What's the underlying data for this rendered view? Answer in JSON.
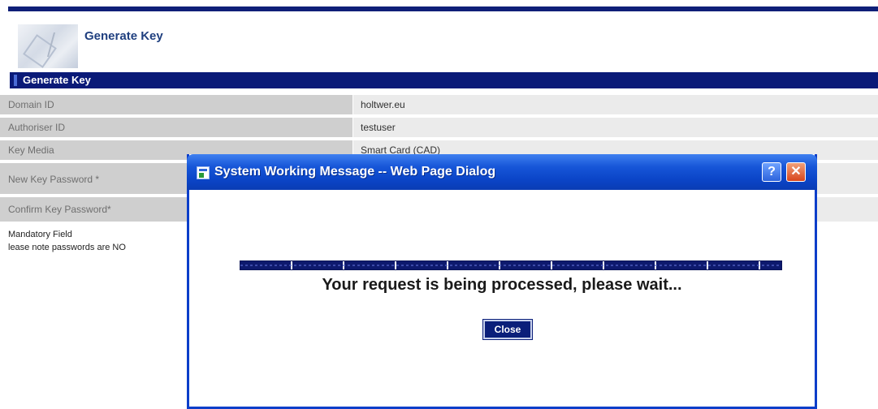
{
  "header": {
    "title": "Generate Key"
  },
  "section": {
    "title": "Generate Key"
  },
  "form": {
    "rows": [
      {
        "label": "Domain ID",
        "value": "holtwer.eu"
      },
      {
        "label": "Authoriser ID",
        "value": "testuser"
      },
      {
        "label": "Key Media",
        "value": "Smart Card (CAD)"
      },
      {
        "label": "New Key Password *",
        "value": ""
      },
      {
        "label": "Confirm Key Password*",
        "value": ""
      }
    ]
  },
  "notes": {
    "mandatory": "Mandatory Field",
    "passwords": "lease note passwords are NO"
  },
  "dialog": {
    "title": "System Working Message -- Web Page Dialog",
    "help_label": "?",
    "close_x_label": "✕",
    "message": "Your request is being processed, please wait...",
    "close_button": "Close"
  },
  "colors": {
    "accent": "#0a1a78",
    "dialog_title_bg": "#1756d8",
    "close_x_bg": "#d8461c"
  }
}
